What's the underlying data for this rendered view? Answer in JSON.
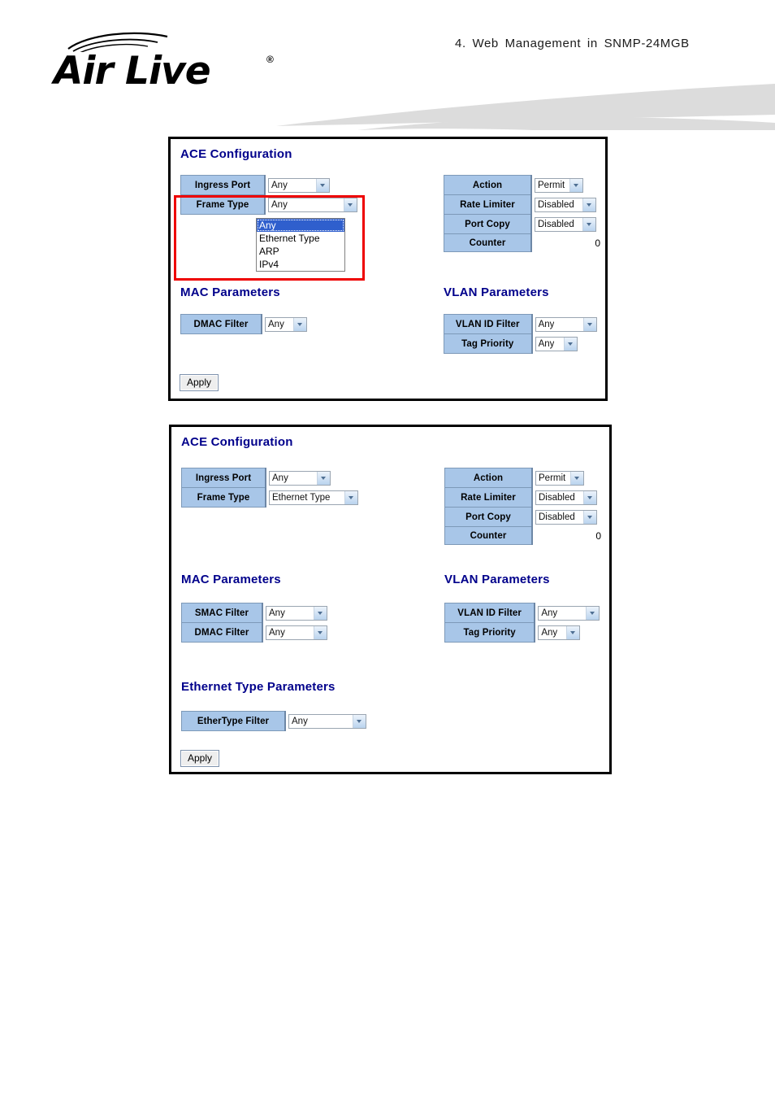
{
  "header": {
    "brand": "Air Live",
    "brand_mark": "®",
    "chapter_title": "4.   Web  Management  in  SNMP-24MGB"
  },
  "panels": [
    {
      "id": "acl-any",
      "title": "ACE Configuration",
      "left_table": {
        "rows": [
          {
            "label": "Ingress Port",
            "value": "Any"
          },
          {
            "label": "Frame Type",
            "value": "Any"
          }
        ]
      },
      "frame_type_dropdown": {
        "open": true,
        "options": [
          "Any",
          "Ethernet Type",
          "ARP",
          "IPv4"
        ],
        "selected": "Any"
      },
      "right_table": {
        "rows": [
          {
            "label": "Action",
            "value": "Permit"
          },
          {
            "label": "Rate Limiter",
            "value": "Disabled"
          },
          {
            "label": "Port Copy",
            "value": "Disabled"
          },
          {
            "label": "Counter",
            "value": "0"
          }
        ]
      },
      "mac_section": {
        "title": "MAC Parameters",
        "rows": [
          {
            "label": "DMAC Filter",
            "value": "Any"
          }
        ]
      },
      "vlan_section": {
        "title": "VLAN Parameters",
        "rows": [
          {
            "label": "VLAN ID Filter",
            "value": "Any"
          },
          {
            "label": "Tag Priority",
            "value": "Any"
          }
        ]
      },
      "apply_label": "Apply",
      "annotation_color": "#ee0000"
    },
    {
      "id": "acl-ether",
      "title": "ACE Configuration",
      "left_table": {
        "rows": [
          {
            "label": "Ingress Port",
            "value": "Any"
          },
          {
            "label": "Frame Type",
            "value": "Ethernet Type"
          }
        ]
      },
      "right_table": {
        "rows": [
          {
            "label": "Action",
            "value": "Permit"
          },
          {
            "label": "Rate Limiter",
            "value": "Disabled"
          },
          {
            "label": "Port Copy",
            "value": "Disabled"
          },
          {
            "label": "Counter",
            "value": "0"
          }
        ]
      },
      "mac_section": {
        "title": "MAC Parameters",
        "rows": [
          {
            "label": "SMAC Filter",
            "value": "Any"
          },
          {
            "label": "DMAC Filter",
            "value": "Any"
          }
        ]
      },
      "vlan_section": {
        "title": "VLAN Parameters",
        "rows": [
          {
            "label": "VLAN ID Filter",
            "value": "Any"
          },
          {
            "label": "Tag Priority",
            "value": "Any"
          }
        ]
      },
      "ethertype_section": {
        "title": "Ethernet Type Parameters",
        "rows": [
          {
            "label": "EtherType Filter",
            "value": "Any"
          }
        ]
      },
      "apply_label": "Apply"
    }
  ],
  "colors": {
    "label_cell": "#a8c6e8",
    "section_title": "#00008b",
    "annotation": "#ee0000",
    "swoosh": "#dcdcdc"
  }
}
